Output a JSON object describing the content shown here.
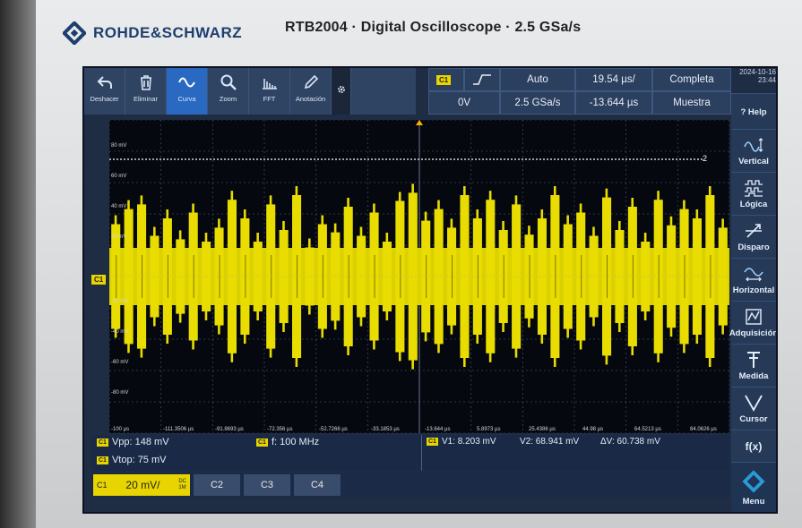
{
  "device": {
    "brand": "ROHDE&SCHWARZ",
    "model_line": "RTB2004 · Digital Oscilloscope · 2.5 GSa/s"
  },
  "toolbar": {
    "buttons": [
      {
        "label": "Deshacer",
        "icon": "undo-icon"
      },
      {
        "label": "Eliminar",
        "icon": "trash-icon"
      },
      {
        "label": "Curva",
        "icon": "waveform-icon",
        "active": true
      },
      {
        "label": "Zoom",
        "icon": "magnifier-icon"
      },
      {
        "label": "FFT",
        "icon": "fft-icon"
      },
      {
        "label": "Anotación",
        "icon": "pencil-icon"
      }
    ]
  },
  "status": {
    "trigger_channel": "C1",
    "trigger_level": "0V",
    "trigger_mode": "Auto",
    "sample_rate": "2.5 GSa/s",
    "timebase": "19.54 µs/",
    "trigger_offset": "-13.644 µs",
    "acq_mode": "Completa",
    "acq_type": "Muestra",
    "date": "2024-10-16",
    "time": "23:44"
  },
  "side_menu": [
    {
      "label": "? Help",
      "icon": "help-icon"
    },
    {
      "label": "Vertical",
      "icon": "vertical-icon"
    },
    {
      "label": "Lógica",
      "icon": "logic-icon"
    },
    {
      "label": "Disparo",
      "icon": "trigger-icon"
    },
    {
      "label": "Horizontal",
      "icon": "horizontal-icon"
    },
    {
      "label": "Adquisición",
      "icon": "acquire-icon"
    },
    {
      "label": "Medida",
      "icon": "measure-icon"
    },
    {
      "label": "Cursor",
      "icon": "cursor-icon"
    },
    {
      "label": "f(x)",
      "icon": "fx-icon"
    },
    {
      "label": "Menu",
      "icon": "menu-logo-icon"
    }
  ],
  "plot": {
    "y_ticks": [
      "80 mV",
      "60 mV",
      "40 mV",
      "20 mV",
      "-20 mV",
      "-40 mV",
      "-60 mV",
      "-80 mV"
    ],
    "x_ticks": [
      "-100 µs",
      "-111.3506 µs",
      "-91.8693 µs",
      "-72.356 µs",
      "-52.7266 µs",
      "-33.1853 µs",
      "-13.644 µs",
      "5.8973 µs",
      "25.4386 µs",
      "44.98 µs",
      "64.5213 µs",
      "84.0626 µs"
    ],
    "channel_marker": "C1",
    "cursor_marker": "2",
    "trace_color": "#e8dc00",
    "cursor_color": "#ffffff"
  },
  "measurements": {
    "vpp": "Vpp: 148 mV",
    "vtop": "Vtop: 75 mV",
    "freq": "f: 100 MHz",
    "v1": "V1: 8.203 mV",
    "v2": "V2: 68.941 mV",
    "dv": "ΔV: 60.738 mV",
    "c1_tag": "C1"
  },
  "channels": {
    "c1_label": "C1",
    "c1_scale": "20 mV/",
    "c1_coupling": "DC",
    "c1_impedance": "1M",
    "c2": "C2",
    "c3": "C3",
    "c4": "C4"
  }
}
